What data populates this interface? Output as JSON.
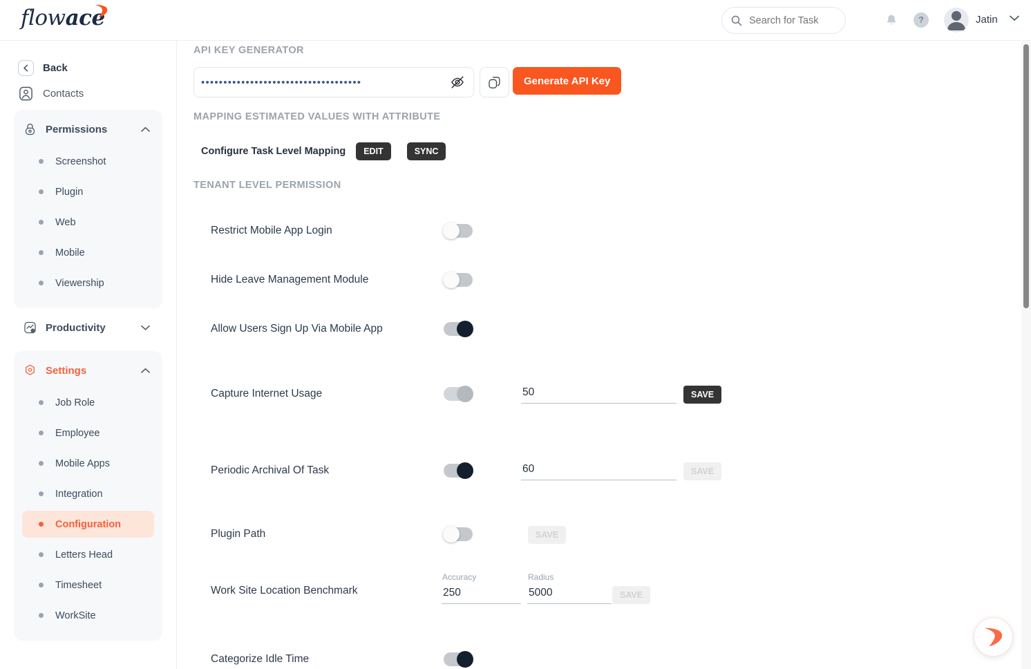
{
  "app": {
    "brand_light": "flow",
    "brand_bold": "ace",
    "accent_color": "#fa5620"
  },
  "header": {
    "search": {
      "placeholder": "Search for Task",
      "value": ""
    },
    "notifications_icon": "bell-icon",
    "help_icon": "help-icon",
    "help_label": "?",
    "user_name": "Jatin"
  },
  "sidebar": {
    "back_label": "Back",
    "contacts_label": "Contacts",
    "groups": [
      {
        "label": "Permissions",
        "icon": "lock-icon",
        "expanded": true,
        "active": false,
        "items": [
          {
            "label": "Screenshot",
            "selected": false
          },
          {
            "label": "Plugin",
            "selected": false
          },
          {
            "label": "Web",
            "selected": false
          },
          {
            "label": "Mobile",
            "selected": false
          },
          {
            "label": "Viewership",
            "selected": false
          }
        ]
      },
      {
        "label": "Productivity",
        "icon": "chart-star-icon",
        "expanded": false,
        "active": false,
        "items": []
      },
      {
        "label": "Settings",
        "icon": "gear-hex-icon",
        "expanded": true,
        "active": true,
        "items": [
          {
            "label": "Job Role",
            "selected": false
          },
          {
            "label": "Employee",
            "selected": false
          },
          {
            "label": "Mobile Apps",
            "selected": false
          },
          {
            "label": "Integration",
            "selected": false
          },
          {
            "label": "Configuration",
            "selected": true
          },
          {
            "label": "Letters Head",
            "selected": false
          },
          {
            "label": "Timesheet",
            "selected": false
          },
          {
            "label": "WorkSite",
            "selected": false
          }
        ]
      }
    ]
  },
  "main": {
    "api_section": {
      "title": "API KEY GENERATOR",
      "key_masked": "••••••••••••••••••••••••••••••••••••",
      "eye_icon": "eye-off-icon",
      "copy_icon": "copy-icon",
      "generate_label": "Generate API Key"
    },
    "mapping_section": {
      "title": "MAPPING ESTIMATED VALUES WITH ATTRIBUTE",
      "row_label": "Configure Task Level Mapping",
      "edit_label": "EDIT",
      "sync_label": "SYNC"
    },
    "tenant_section": {
      "title": "TENANT LEVEL PERMISSION",
      "rows": [
        {
          "label": "Restrict Mobile App Login",
          "toggle": "off"
        },
        {
          "label": "Hide Leave Management Module",
          "toggle": "off"
        },
        {
          "label": "Allow Users Sign Up Via Mobile App",
          "toggle": "on"
        },
        {
          "label": "Capture Internet Usage",
          "toggle": "on-disabled",
          "value": "50",
          "save_label": "SAVE",
          "save_enabled": true
        },
        {
          "label": "Periodic Archival Of Task",
          "toggle": "on",
          "value": "60",
          "save_label": "SAVE",
          "save_enabled": false
        },
        {
          "label": "Plugin Path",
          "toggle": "off",
          "save_label": "SAVE",
          "save_enabled": false
        },
        {
          "label": "Work Site Location Benchmark",
          "accuracy_caption": "Accuracy",
          "accuracy_value": "250",
          "radius_caption": "Radius",
          "radius_value": "5000",
          "save_label": "SAVE",
          "save_enabled": false
        },
        {
          "label": "Categorize Idle Time",
          "toggle": "on"
        }
      ]
    }
  },
  "chat_widget": {
    "icon": "flowace-swoosh-icon"
  }
}
